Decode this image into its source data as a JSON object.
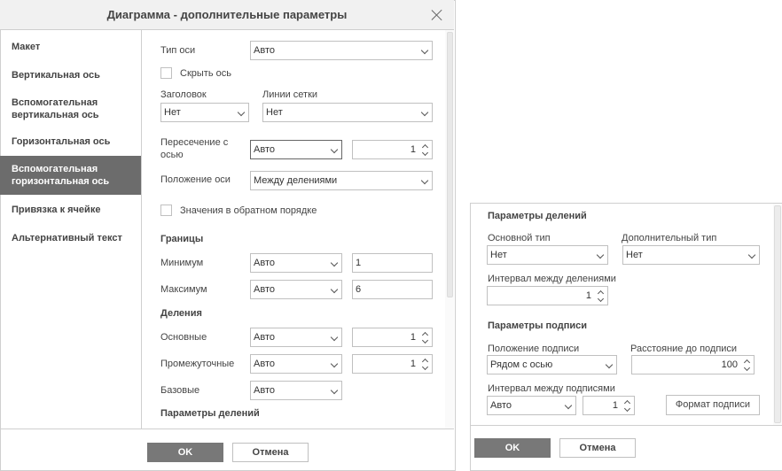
{
  "dialog": {
    "title": "Диаграмма - дополнительные параметры",
    "sidebar": [
      {
        "label": "Макет",
        "selected": false
      },
      {
        "label": "Вертикальная ось",
        "selected": false
      },
      {
        "label": "Вспомогательная вертикальная ось",
        "selected": false
      },
      {
        "label": "Горизонтальная ось",
        "selected": false
      },
      {
        "label": "Вспомогательная горизонтальная ось",
        "selected": true
      },
      {
        "label": "Привязка к ячейке",
        "selected": false
      },
      {
        "label": "Альтернативный текст",
        "selected": false
      }
    ],
    "axis": {
      "type_label": "Тип оси",
      "type_value": "Авто",
      "hide_axis_label": "Скрыть ось",
      "title_label": "Заголовок",
      "title_value": "Нет",
      "gridlines_label": "Линии сетки",
      "gridlines_value": "Нет",
      "crosses_label": "Пересечение с осью",
      "crosses_value": "Авто",
      "crosses_number": "1",
      "position_label": "Положение оси",
      "position_value": "Между делениями",
      "reverse_label": "Значения в обратном порядке"
    },
    "bounds": {
      "heading": "Границы",
      "min_label": "Минимум",
      "min_value": "Авто",
      "min_number": "1",
      "max_label": "Максимум",
      "max_value": "Авто",
      "max_number": "6"
    },
    "units": {
      "heading": "Деления",
      "major_label": "Основные",
      "major_value": "Авто",
      "major_number": "1",
      "minor_label": "Промежуточные",
      "minor_value": "Авто",
      "minor_number": "1",
      "base_label": "Базовые",
      "base_value": "Авто"
    },
    "tick_params_heading": "Параметры делений",
    "ok_label": "OK",
    "cancel_label": "Отмена"
  },
  "dialog2": {
    "tick_heading": "Параметры делений",
    "major_type_label": "Основной тип",
    "major_type_value": "Нет",
    "minor_type_label": "Дополнительный тип",
    "minor_type_value": "Нет",
    "tick_interval_label": "Интервал между делениями",
    "tick_interval_value": "1",
    "label_heading": "Параметры подписи",
    "label_position_label": "Положение подписи",
    "label_position_value": "Рядом с осью",
    "label_distance_label": "Расстояние до подписи",
    "label_distance_value": "100",
    "label_interval_label": "Интервал между подписями",
    "label_interval_value": "Авто",
    "label_interval_number": "1",
    "format_button": "Формат подписи",
    "ok_label": "OK",
    "cancel_label": "Отмена"
  },
  "icons": {
    "close": "close-icon",
    "dropdown": "chevron-down-icon",
    "spin_up": "chevron-up-icon",
    "spin_down": "chevron-down-icon"
  },
  "colors": {
    "selected_sidebar": "#6c6c6c",
    "primary_button": "#787878"
  }
}
